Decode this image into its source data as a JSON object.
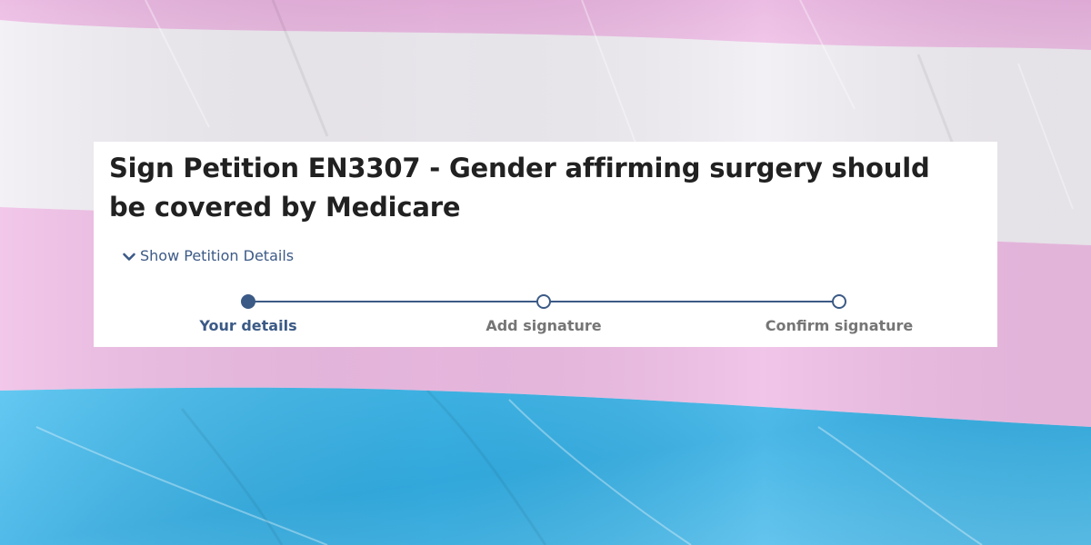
{
  "petition": {
    "title": "Sign Petition EN3307 - Gender affirming surgery should be covered by Medicare",
    "show_details_label": "Show Petition Details"
  },
  "stepper": {
    "steps": [
      {
        "label": "Your details",
        "state": "active"
      },
      {
        "label": "Add signature",
        "state": "pending"
      },
      {
        "label": "Confirm signature",
        "state": "pending"
      }
    ]
  },
  "icons": {
    "toggle": "chevron-down-icon"
  },
  "colors": {
    "accent": "#3b5a86",
    "link": "#3c5a87",
    "title": "#212121",
    "inactive_label": "#757575",
    "flag_pink": "#efb9e3",
    "flag_white": "#f1eef4",
    "flag_blue": "#3fb6e6"
  }
}
